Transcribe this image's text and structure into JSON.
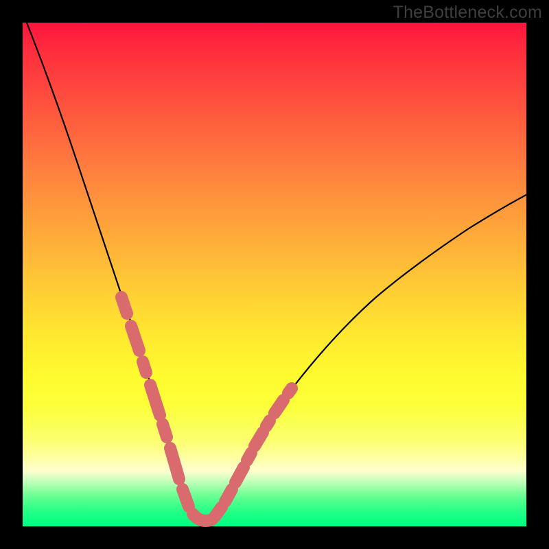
{
  "watermark": "TheBottleneck.com",
  "chart_data": {
    "type": "line",
    "title": "",
    "xlabel": "",
    "ylabel": "",
    "xlim": [
      0,
      100
    ],
    "ylim": [
      0,
      100
    ],
    "grid": false,
    "legend": false,
    "series": [
      {
        "name": "bottleneck-curve",
        "x": [
          0,
          5,
          10,
          15,
          18,
          20,
          22,
          24,
          26,
          28,
          30,
          31,
          32,
          33,
          34,
          35,
          36,
          37,
          38,
          40,
          45,
          50,
          55,
          60,
          65,
          70,
          75,
          80,
          85,
          90,
          95,
          100
        ],
        "values": [
          102,
          92,
          80,
          66,
          57,
          50,
          43,
          35,
          27,
          18,
          10,
          7,
          5,
          3,
          2,
          2,
          2,
          3,
          5,
          8,
          17,
          25,
          32,
          38,
          44,
          49,
          54,
          58,
          62,
          66,
          69,
          72
        ]
      }
    ],
    "highlighted_segments": [
      {
        "name": "left-arm-thick",
        "x_range": [
          18,
          32
        ],
        "y_range": [
          57,
          5
        ]
      },
      {
        "name": "valley-thick",
        "x_range": [
          32,
          37
        ],
        "y_range": [
          5,
          3
        ]
      },
      {
        "name": "right-arm-thick",
        "x_range": [
          37,
          47
        ],
        "y_range": [
          3,
          20
        ]
      }
    ],
    "colors": {
      "curve": "#000000",
      "highlight": "#d96b6f",
      "gradient_top": "#ff153d",
      "gradient_bottom": "#00ff82"
    }
  }
}
